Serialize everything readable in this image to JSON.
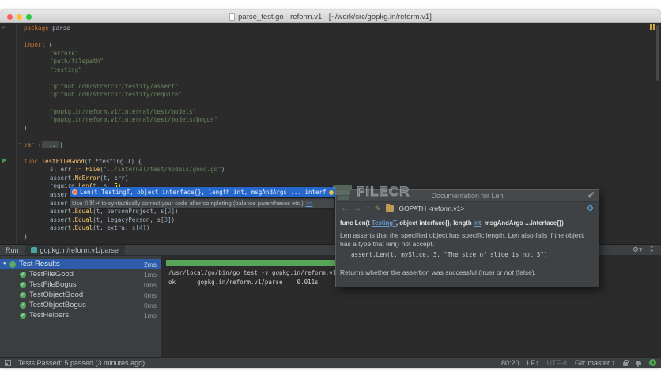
{
  "window": {
    "title": "parse_test.go - reform.v1 - [~/work/src/gopkg.in/reform.v1]"
  },
  "icons": {
    "run_file": "»",
    "run_test": "▶",
    "fold": "−",
    "collapse_arrow": "▼",
    "check": "✓",
    "back": "←",
    "forward": "→",
    "up": "↑",
    "edit": "✎",
    "gear": "⚙",
    "gear_caret": "▾",
    "hide": "↧"
  },
  "editor": {
    "lines": [
      {
        "i": 0,
        "s": [
          {
            "t": "package ",
            "c": "k"
          },
          {
            "t": "parse",
            "c": "d"
          }
        ]
      },
      {
        "i": 0,
        "s": []
      },
      {
        "i": 0,
        "s": [
          {
            "t": "import ",
            "c": "k"
          },
          {
            "t": "(",
            "c": "d"
          }
        ]
      },
      {
        "i": 1,
        "s": [
          {
            "t": "\"errors\"",
            "c": "s"
          }
        ]
      },
      {
        "i": 1,
        "s": [
          {
            "t": "\"path/filepath\"",
            "c": "s"
          }
        ]
      },
      {
        "i": 1,
        "s": [
          {
            "t": "\"testing\"",
            "c": "s"
          }
        ]
      },
      {
        "i": 0,
        "s": []
      },
      {
        "i": 1,
        "s": [
          {
            "t": "\"github.com/stretchr/testify/assert\"",
            "c": "s"
          }
        ]
      },
      {
        "i": 1,
        "s": [
          {
            "t": "\"github.com/stretchr/testify/require\"",
            "c": "s"
          }
        ]
      },
      {
        "i": 0,
        "s": []
      },
      {
        "i": 1,
        "s": [
          {
            "t": "\"gopkg.in/reform.v1/internal/test/models\"",
            "c": "s"
          }
        ]
      },
      {
        "i": 1,
        "s": [
          {
            "t": "\"gopkg.in/reform.v1/internal/test/models/bogus\"",
            "c": "s"
          }
        ]
      },
      {
        "i": 0,
        "s": [
          {
            "t": ")",
            "c": "d"
          }
        ]
      },
      {
        "i": 0,
        "s": []
      },
      {
        "i": 0,
        "s": [
          {
            "t": "var ",
            "c": "k"
          },
          {
            "t": "(",
            "c": "d"
          },
          {
            "t": " ... ",
            "c": "o"
          },
          {
            "t": ")",
            "c": "d"
          }
        ]
      },
      {
        "i": 0,
        "s": []
      },
      {
        "i": 0,
        "s": [
          {
            "t": "func ",
            "c": "k"
          },
          {
            "t": "TestFileGood",
            "c": "f"
          },
          {
            "t": "(t *testing.T) {",
            "c": "d"
          }
        ]
      },
      {
        "i": 1,
        "s": [
          {
            "t": "s, err ",
            "c": "d"
          },
          {
            "t": ":= ",
            "c": "k"
          },
          {
            "t": "File",
            "c": "f"
          },
          {
            "t": "(",
            "c": "d"
          },
          {
            "t": "\"../internal/test/models/good.go\"",
            "c": "s"
          },
          {
            "t": ")",
            "c": "d"
          }
        ]
      },
      {
        "i": 1,
        "s": [
          {
            "t": "assert.",
            "c": "d"
          },
          {
            "t": "NoError",
            "c": "f"
          },
          {
            "t": "(t, err)",
            "c": "d"
          }
        ]
      },
      {
        "i": 1,
        "s": [
          {
            "t": "require.",
            "c": "d"
          },
          {
            "t": "Len",
            "c": "f"
          },
          {
            "t": "(",
            "c": "p"
          },
          {
            "t": "t, s, ",
            "c": "d"
          },
          {
            "t": "5)",
            "c": "p"
          }
        ]
      },
      {
        "i": 1,
        "s": [
          {
            "t": "asser",
            "c": "d"
          }
        ]
      },
      {
        "i": 1,
        "s": [
          {
            "t": "asser",
            "c": "d"
          }
        ]
      },
      {
        "i": 1,
        "s": [
          {
            "t": "assert.",
            "c": "d"
          },
          {
            "t": "Equal",
            "c": "f"
          },
          {
            "t": "(t, personProject, s[",
            "c": "d"
          },
          {
            "t": "2",
            "c": "n"
          },
          {
            "t": "])",
            "c": "d"
          }
        ]
      },
      {
        "i": 1,
        "s": [
          {
            "t": "assert.",
            "c": "d"
          },
          {
            "t": "Equal",
            "c": "f"
          },
          {
            "t": "(t, legacyPerson, s[",
            "c": "d"
          },
          {
            "t": "3",
            "c": "n"
          },
          {
            "t": "])",
            "c": "d"
          }
        ]
      },
      {
        "i": 1,
        "s": [
          {
            "t": "assert.",
            "c": "d"
          },
          {
            "t": "Equal",
            "c": "f"
          },
          {
            "t": "(t, extra, s[",
            "c": "d"
          },
          {
            "t": "4",
            "c": "n"
          },
          {
            "t": "])",
            "c": "d"
          }
        ]
      },
      {
        "i": 0,
        "s": [
          {
            "t": "}",
            "c": "d"
          }
        ]
      }
    ]
  },
  "completion_popup": {
    "text": "Len(t TestingT, object interface{}, length int, msgAndArgs ... interf"
  },
  "hint_popup": {
    "text": "Use ⇧⌘↵ to syntactically correct your code after completing (balance parentheses etc.)",
    "link": ">>"
  },
  "doc_popup": {
    "title": "Documentation for Len",
    "toolbar": {
      "location": "GOPATH <reform.v1>"
    },
    "signature": {
      "pre": "func Len(t ",
      "link1": "TestingT",
      "mid1": ", object interface{}, length ",
      "link2": "int",
      "post": ", msgAndArgs …interface{})"
    },
    "body": "Len asserts that the specified object has specific length. Len also fails if the object has a type that len() not accept.",
    "code": "assert.Len(t, mySlice, 3, \"The size of slice is not 3\")",
    "returns_pre": "Returns whether the assertion was successful (true) or ",
    "returns_italic": "not",
    "returns_post": " (false)."
  },
  "watermark": {
    "text": "FILECR"
  },
  "run_panel": {
    "label": "Run",
    "tab": "gopkg.in/reform.v1/parse",
    "tree": [
      {
        "label": "Test Results",
        "time": "2ms",
        "selected": true,
        "root": true
      },
      {
        "label": "TestFileGood",
        "time": "1ms"
      },
      {
        "label": "TestFileBogus",
        "time": "0ms"
      },
      {
        "label": "TestObjectGood",
        "time": "0ms"
      },
      {
        "label": "TestObjectBogus",
        "time": "0ms"
      },
      {
        "label": "TestHelpers",
        "time": "1ms"
      }
    ],
    "console": [
      "/usr/local/go/bin/go test -v gopkg.in/reform.v1/parse",
      "ok      gopkg.in/reform.v1/parse    0.011s"
    ]
  },
  "status_bar": {
    "left": "Tests Passed: 5 passed (3 minutes ago)",
    "position": "80:20",
    "line_ending": "LF↕",
    "encoding": "UTF-8",
    "git": "Git: master ↕"
  }
}
